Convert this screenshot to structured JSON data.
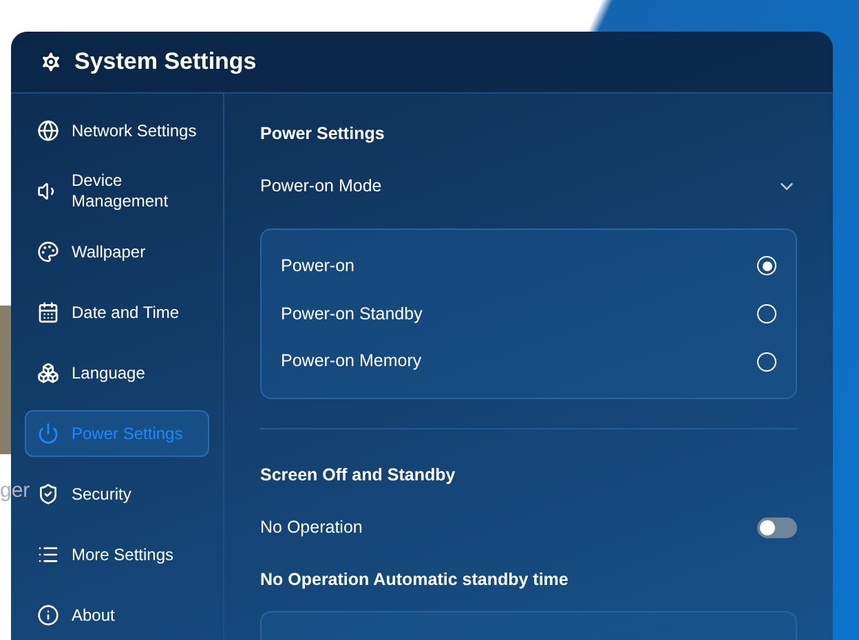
{
  "desktop": {
    "label": "ger"
  },
  "window": {
    "title": "System Settings"
  },
  "sidebar": {
    "items": [
      {
        "label": "Network Settings",
        "selected": false
      },
      {
        "label": "Device Management",
        "selected": false
      },
      {
        "label": "Wallpaper",
        "selected": false
      },
      {
        "label": "Date and Time",
        "selected": false
      },
      {
        "label": "Language",
        "selected": false
      },
      {
        "label": "Power Settings",
        "selected": true
      },
      {
        "label": "Security",
        "selected": false
      },
      {
        "label": "More Settings",
        "selected": false
      },
      {
        "label": "About",
        "selected": false
      }
    ]
  },
  "content": {
    "title": "Power Settings",
    "power_on_mode": {
      "label": "Power-on Mode",
      "expanded": true,
      "options": [
        {
          "label": "Power-on",
          "selected": true
        },
        {
          "label": "Power-on Standby",
          "selected": false
        },
        {
          "label": "Power-on Memory",
          "selected": false
        }
      ]
    },
    "screen_section": {
      "title": "Screen Off and Standby",
      "toggle": {
        "label": "No Operation",
        "on": false
      },
      "subtitle": "No Operation Automatic standby time"
    }
  }
}
